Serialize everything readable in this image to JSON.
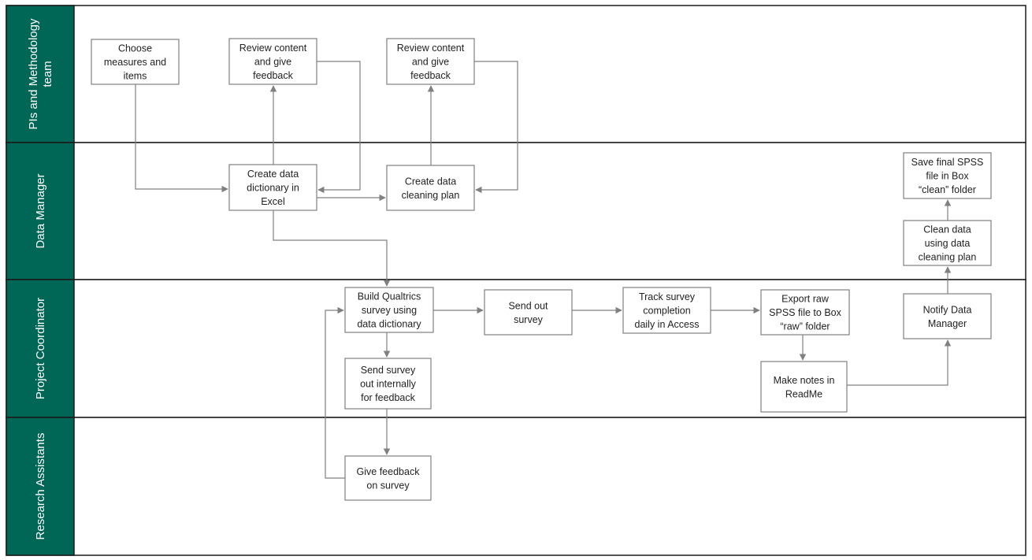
{
  "theme": {
    "lane_header_color": "#006655",
    "box_border_color": "#808080",
    "connector_color": "#808080"
  },
  "lanes": [
    {
      "id": "pis",
      "label_lines": [
        "PIs and Methodology",
        "team"
      ]
    },
    {
      "id": "dm",
      "label_lines": [
        "Data Manager"
      ]
    },
    {
      "id": "pc",
      "label_lines": [
        "Project Coordinator"
      ]
    },
    {
      "id": "ra",
      "label_lines": [
        "Research Assistants"
      ]
    }
  ],
  "steps": [
    {
      "id": "choose-measures",
      "lane": "pis",
      "lines": [
        "Choose",
        "measures and",
        "items"
      ]
    },
    {
      "id": "review-content-1",
      "lane": "pis",
      "lines": [
        "Review content",
        "and give",
        "feedback"
      ]
    },
    {
      "id": "review-content-2",
      "lane": "pis",
      "lines": [
        "Review content",
        "and give",
        "feedback"
      ]
    },
    {
      "id": "create-data-dictionary",
      "lane": "dm",
      "lines": [
        "Create data",
        "dictionary in",
        "Excel"
      ]
    },
    {
      "id": "create-cleaning-plan",
      "lane": "dm",
      "lines": [
        "Create data",
        "cleaning plan"
      ]
    },
    {
      "id": "save-final-spss",
      "lane": "dm",
      "lines": [
        "Save final SPSS",
        "file in Box",
        "“clean” folder"
      ]
    },
    {
      "id": "clean-data",
      "lane": "dm",
      "lines": [
        "Clean data",
        "using data",
        "cleaning plan"
      ]
    },
    {
      "id": "build-qualtrics",
      "lane": "pc",
      "lines": [
        "Build Qualtrics",
        "survey using",
        "data dictionary"
      ]
    },
    {
      "id": "send-out-survey",
      "lane": "pc",
      "lines": [
        "Send out",
        "survey"
      ]
    },
    {
      "id": "track-completion",
      "lane": "pc",
      "lines": [
        "Track survey",
        "completion",
        "daily in Access"
      ]
    },
    {
      "id": "export-raw-spss",
      "lane": "pc",
      "lines": [
        "Export raw",
        "SPSS file to Box",
        "“raw” folder"
      ]
    },
    {
      "id": "notify-data-manager",
      "lane": "pc",
      "lines": [
        "Notify Data",
        "Manager"
      ]
    },
    {
      "id": "send-internally",
      "lane": "pc",
      "lines": [
        "Send survey",
        "out internally",
        "for feedback"
      ]
    },
    {
      "id": "make-notes-readme",
      "lane": "pc",
      "lines": [
        "Make notes in",
        "ReadMe"
      ]
    },
    {
      "id": "give-feedback",
      "lane": "ra",
      "lines": [
        "Give feedback",
        "on survey"
      ]
    }
  ],
  "flows": [
    {
      "from": "choose-measures",
      "to": "create-data-dictionary"
    },
    {
      "from": "create-data-dictionary",
      "to": "review-content-1"
    },
    {
      "from": "review-content-1",
      "to": "create-data-dictionary"
    },
    {
      "from": "create-data-dictionary",
      "to": "create-cleaning-plan"
    },
    {
      "from": "create-cleaning-plan",
      "to": "review-content-2"
    },
    {
      "from": "review-content-2",
      "to": "create-cleaning-plan"
    },
    {
      "from": "create-data-dictionary",
      "to": "build-qualtrics"
    },
    {
      "from": "build-qualtrics",
      "to": "send-out-survey"
    },
    {
      "from": "build-qualtrics",
      "to": "send-internally"
    },
    {
      "from": "send-internally",
      "to": "give-feedback"
    },
    {
      "from": "give-feedback",
      "to": "build-qualtrics"
    },
    {
      "from": "send-out-survey",
      "to": "track-completion"
    },
    {
      "from": "track-completion",
      "to": "export-raw-spss"
    },
    {
      "from": "export-raw-spss",
      "to": "make-notes-readme"
    },
    {
      "from": "make-notes-readme",
      "to": "notify-data-manager"
    },
    {
      "from": "notify-data-manager",
      "to": "clean-data"
    },
    {
      "from": "clean-data",
      "to": "save-final-spss"
    }
  ]
}
